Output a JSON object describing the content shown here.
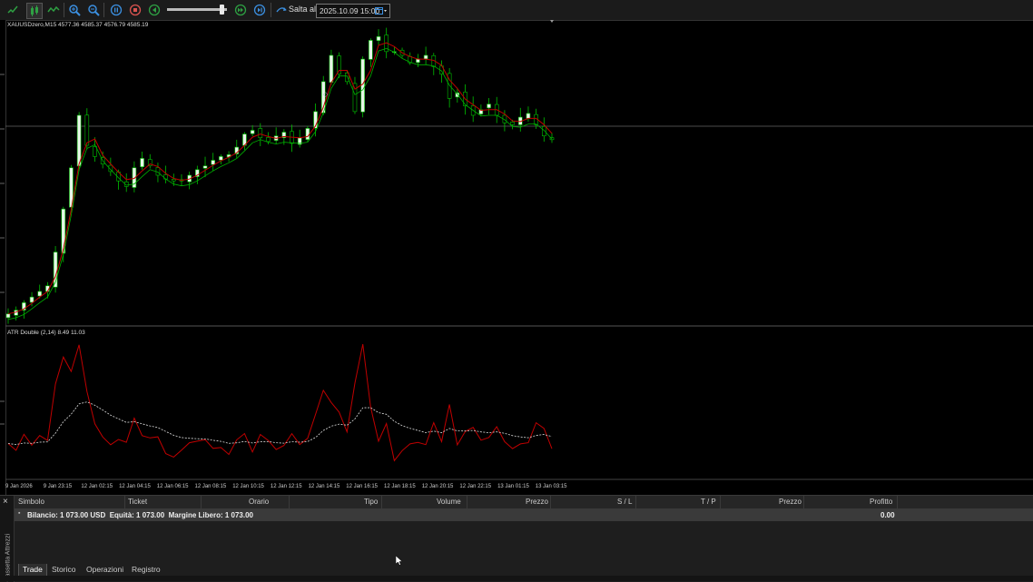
{
  "toolbar": {
    "goto_label": "Salta al",
    "goto_date": "2025.10.09 15:00"
  },
  "main_chart": {
    "label": "XAUUSDzero,M15  4577.36 4585.37 4576.79 4585.19"
  },
  "indicator": {
    "label": "ATR Double (2,14) 8.49 11.03"
  },
  "time_axis": [
    "9 Jan 2026",
    "9 Jan 23:15",
    "12 Jan 02:15",
    "12 Jan 04:15",
    "12 Jan 06:15",
    "12 Jan 08:15",
    "12 Jan 10:15",
    "12 Jan 12:15",
    "12 Jan 14:15",
    "12 Jan 16:15",
    "12 Jan 18:15",
    "12 Jan 20:15",
    "12 Jan 22:15",
    "13 Jan 01:15",
    "13 Jan 03:15"
  ],
  "terminal": {
    "close": "×",
    "side_label": "Cassetta Attrezzi",
    "columns": [
      "Simbolo",
      "Ticket",
      "Orario",
      "Tipo",
      "Volume",
      "Prezzo",
      "S / L",
      "T / P",
      "Prezzo",
      "Profitto"
    ],
    "balance_text": "Bilancio: 1 073.00 USD  Equità: 1 073.00  Margine Libero: 1 073.00",
    "balance_profit": "0.00",
    "tabs": [
      "Trade",
      "Storico",
      "Operazioni",
      "Registro"
    ]
  },
  "colors": {
    "bull_candle": "#e8f5e8",
    "bear_candle": "#000000",
    "wick": "#00c000",
    "ma_line": "#c00000",
    "atr_line": "#c00000",
    "atr_ma": "#dddddd"
  },
  "chart_data": {
    "type": "line",
    "series": [
      {
        "values": [
          4512,
          4514,
          4518,
          4521,
          4524,
          4527,
          4545,
          4568,
          4590,
          4618,
          4602,
          4596,
          4592,
          4588,
          4583,
          4580,
          4590,
          4595,
          4591,
          4586,
          4584,
          4583,
          4583,
          4586,
          4589,
          4591,
          4594,
          4596,
          4597,
          4601,
          4608,
          4610,
          4606,
          4604,
          4607,
          4609,
          4603,
          4606,
          4611,
          4620,
          4636,
          4650,
          4640,
          4636,
          4620,
          4648,
          4658,
          4660,
          4652,
          4652,
          4650,
          4646,
          4648,
          4650,
          4644,
          4640,
          4627,
          4630,
          4623,
          4618,
          4621,
          4624,
          4618,
          4614,
          4613,
          4617,
          4619,
          4613,
          4607,
          4605
        ]
      }
    ]
  }
}
